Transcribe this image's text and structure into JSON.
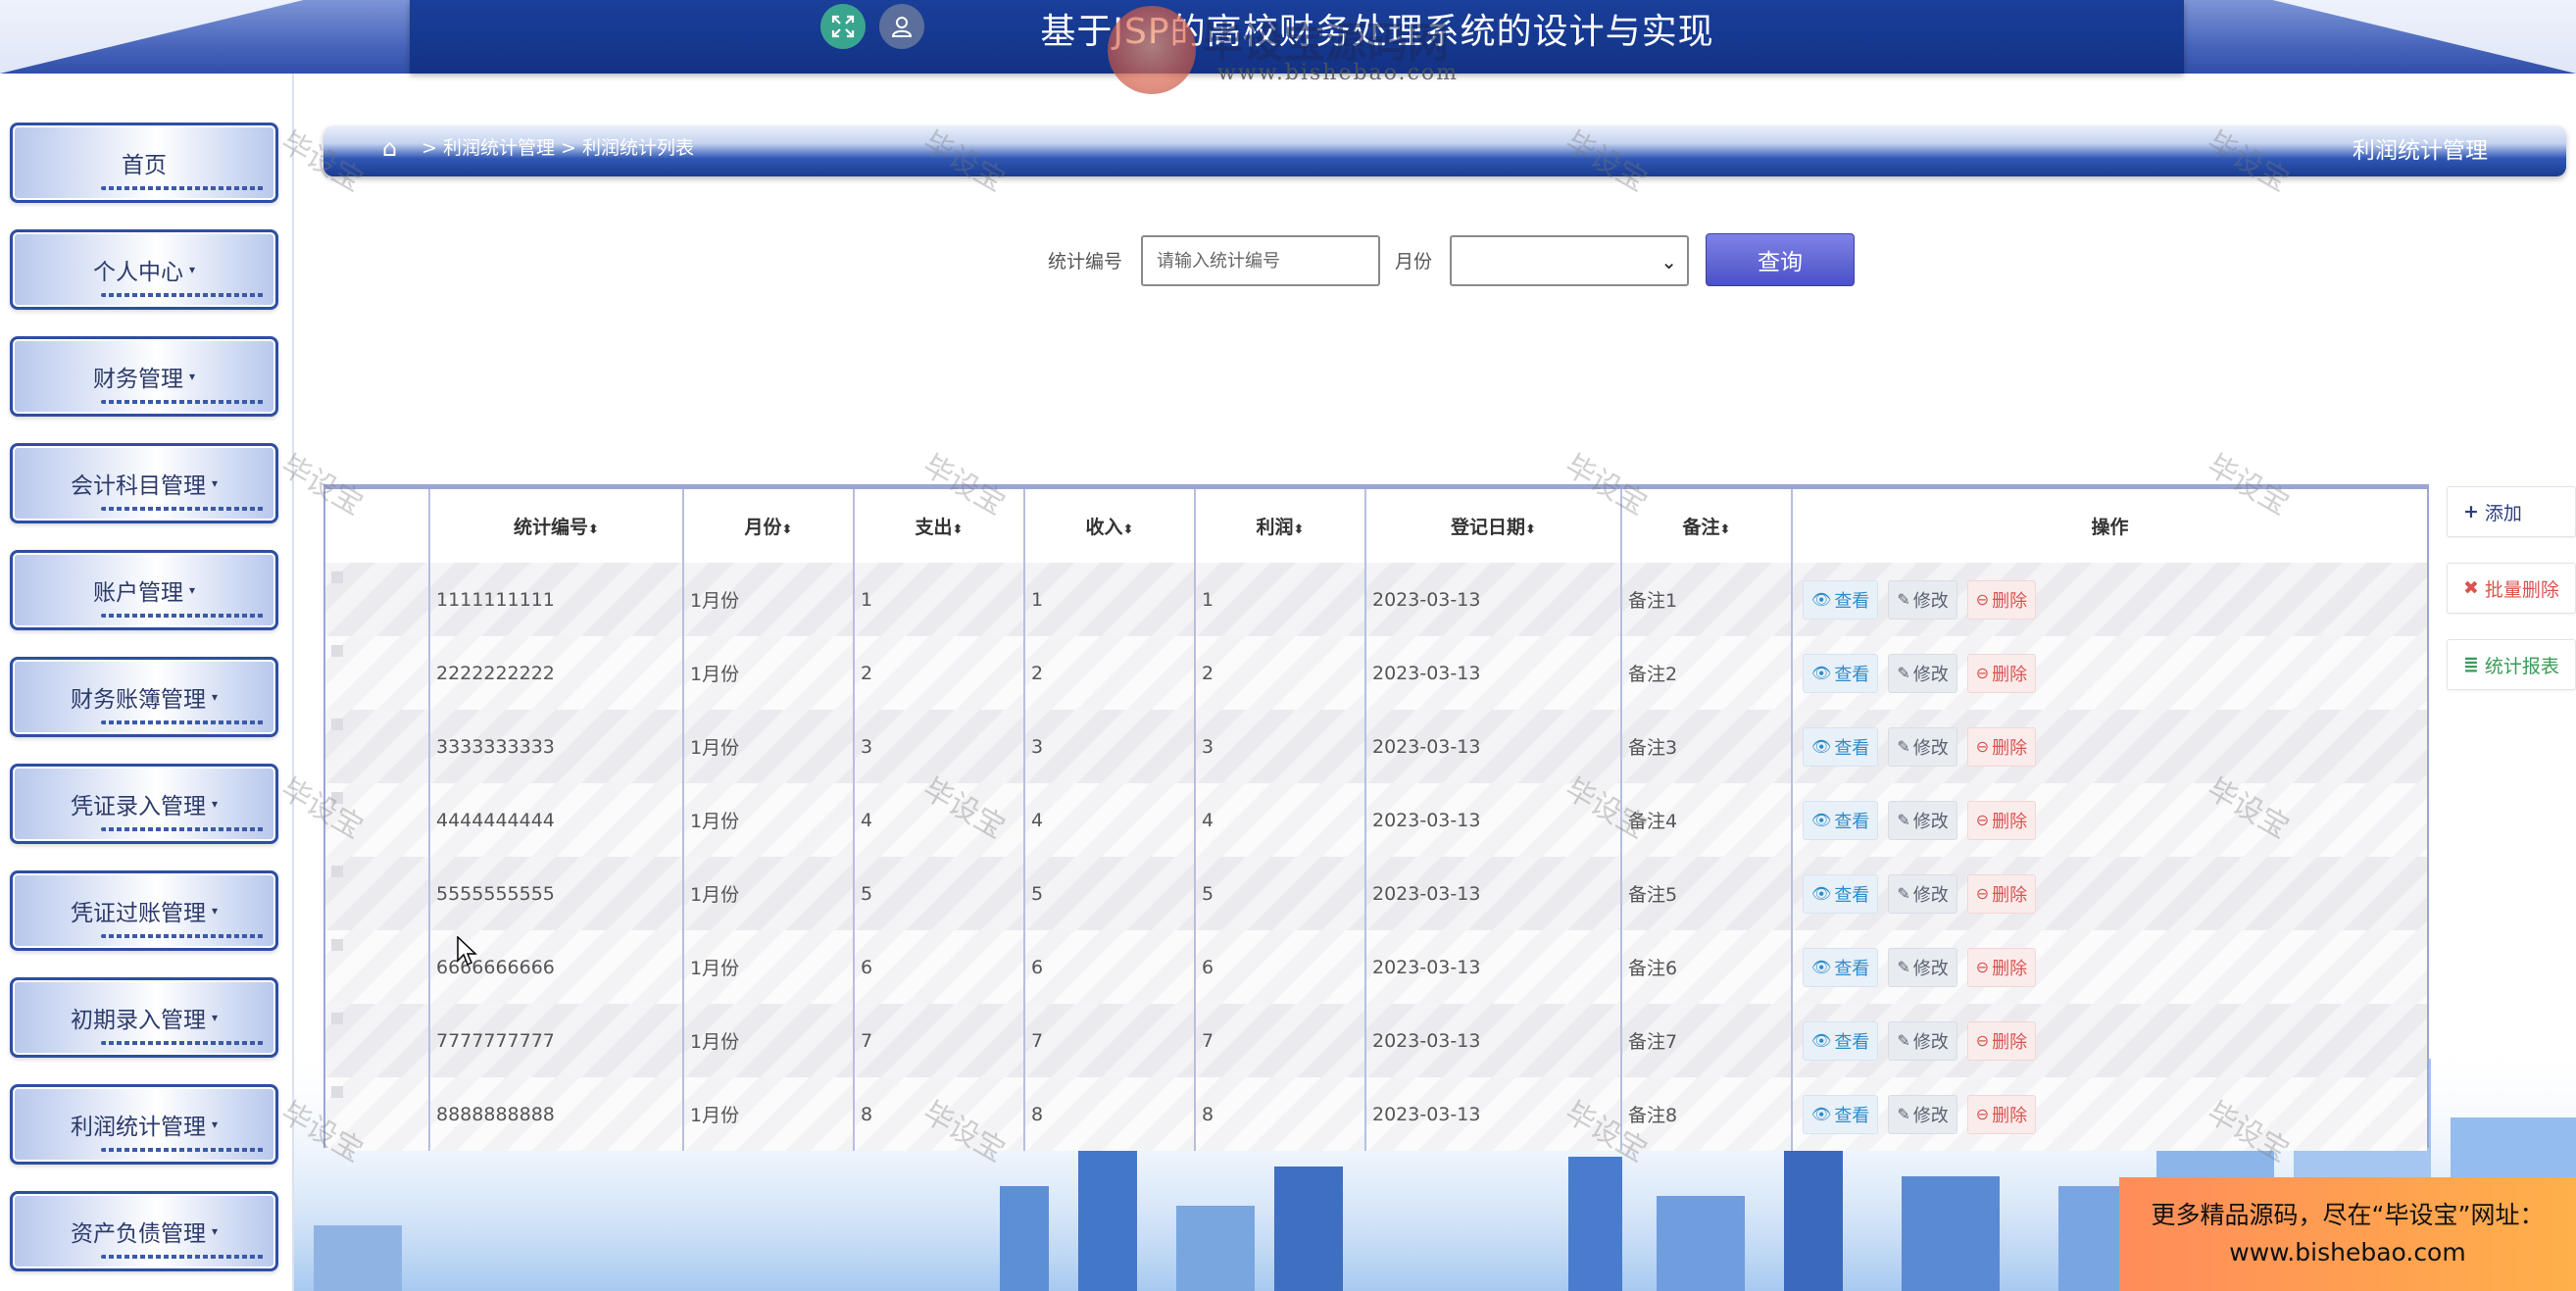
{
  "header": {
    "title": "基于JSP的高校财务处理系统的设计与实现",
    "logo_text": "毕设宝源码网",
    "logo_url": "www.bishebao.com",
    "fullscreen_icon": "expand-icon",
    "user_icon": "user-icon"
  },
  "sidebar": {
    "items": [
      {
        "label": "首页",
        "has_caret": false
      },
      {
        "label": "个人中心",
        "has_caret": true
      },
      {
        "label": "财务管理",
        "has_caret": true
      },
      {
        "label": "会计科目管理",
        "has_caret": true
      },
      {
        "label": "账户管理",
        "has_caret": true
      },
      {
        "label": "财务账簿管理",
        "has_caret": true
      },
      {
        "label": "凭证录入管理",
        "has_caret": true
      },
      {
        "label": "凭证过账管理",
        "has_caret": true
      },
      {
        "label": "初期录入管理",
        "has_caret": true
      },
      {
        "label": "利润统计管理",
        "has_caret": true
      },
      {
        "label": "资产负债管理",
        "has_caret": true
      }
    ],
    "caret": "▾"
  },
  "breadcrumb": {
    "path": "> 利润统计管理 > 利润统计列表",
    "section_title": "利润统计管理",
    "home_icon": "home-icon"
  },
  "search": {
    "code_label": "统计编号",
    "code_placeholder": "请输入统计编号",
    "code_value": "",
    "month_label": "月份",
    "month_value": "",
    "button_label": "查询"
  },
  "table": {
    "columns": [
      "",
      "统计编号",
      "月份",
      "支出",
      "收入",
      "利润",
      "登记日期",
      "备注",
      "操作"
    ],
    "sortable": [
      false,
      true,
      true,
      true,
      true,
      true,
      true,
      true,
      false
    ],
    "sort_mark": "⬍",
    "rows": [
      {
        "code": "1111111111",
        "month": "1月份",
        "expense": "1",
        "income": "1",
        "profit": "1",
        "date": "2023-03-13",
        "note": "备注1"
      },
      {
        "code": "2222222222",
        "month": "1月份",
        "expense": "2",
        "income": "2",
        "profit": "2",
        "date": "2023-03-13",
        "note": "备注2"
      },
      {
        "code": "3333333333",
        "month": "1月份",
        "expense": "3",
        "income": "3",
        "profit": "3",
        "date": "2023-03-13",
        "note": "备注3"
      },
      {
        "code": "4444444444",
        "month": "1月份",
        "expense": "4",
        "income": "4",
        "profit": "4",
        "date": "2023-03-13",
        "note": "备注4"
      },
      {
        "code": "5555555555",
        "month": "1月份",
        "expense": "5",
        "income": "5",
        "profit": "5",
        "date": "2023-03-13",
        "note": "备注5"
      },
      {
        "code": "6666666666",
        "month": "1月份",
        "expense": "6",
        "income": "6",
        "profit": "6",
        "date": "2023-03-13",
        "note": "备注6"
      },
      {
        "code": "7777777777",
        "month": "1月份",
        "expense": "7",
        "income": "7",
        "profit": "7",
        "date": "2023-03-13",
        "note": "备注7"
      },
      {
        "code": "8888888888",
        "month": "1月份",
        "expense": "8",
        "income": "8",
        "profit": "8",
        "date": "2023-03-13",
        "note": "备注8"
      }
    ],
    "actions": {
      "view": "查看",
      "edit": "修改",
      "delete": "删除"
    }
  },
  "side_actions": {
    "add": "添加",
    "batch_delete": "批量删除",
    "report": "统计报表"
  },
  "watermark_text": "毕设宝",
  "promo": {
    "line1": "更多精品源码，尽在“毕设宝”网址：",
    "line2": "www.bishebao.com"
  },
  "colors": {
    "header_blue": "#123285",
    "accent_purple": "#4b51c7",
    "danger": "#d9534f",
    "view": "#2e8cc9",
    "success": "#3a9a56",
    "promo": "#ff9a50"
  }
}
